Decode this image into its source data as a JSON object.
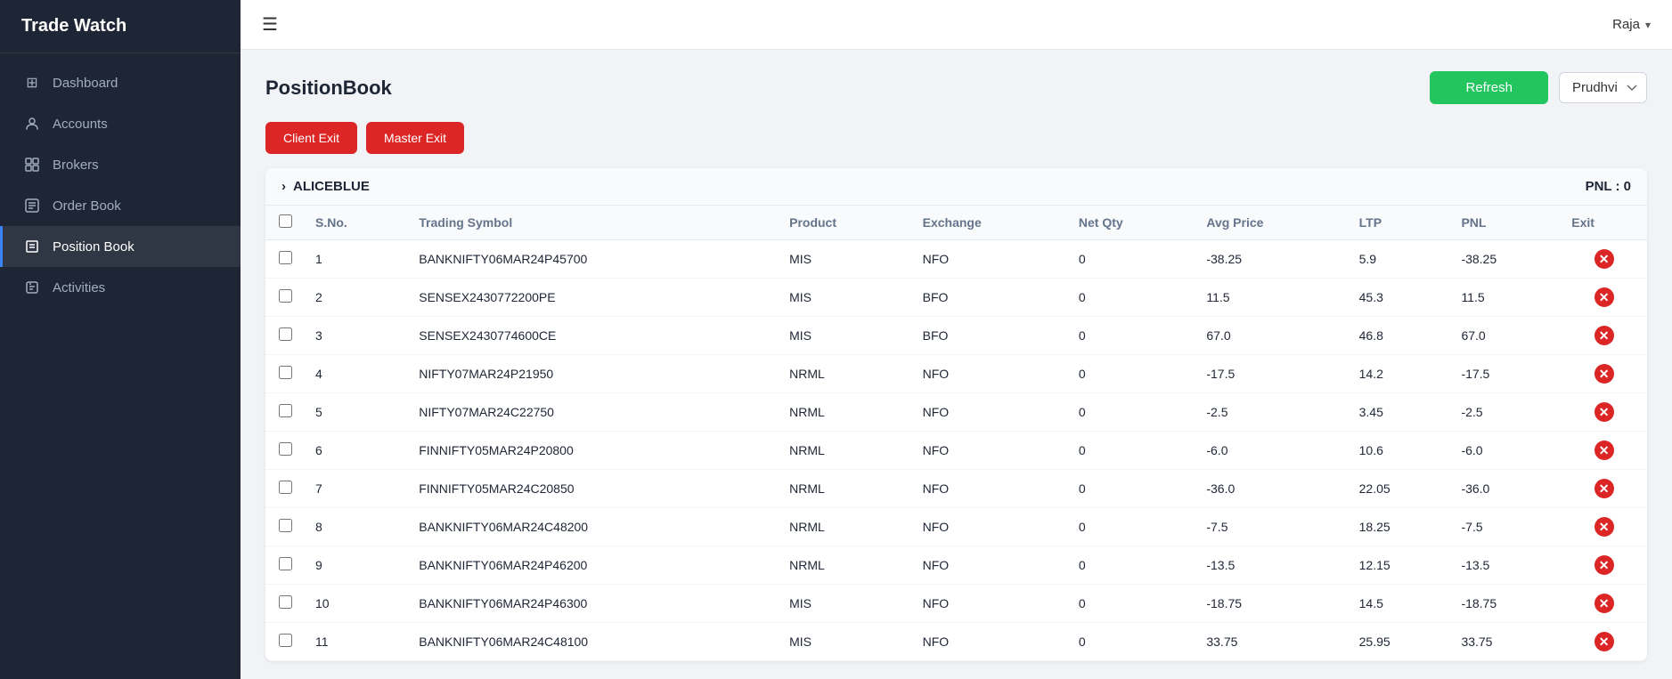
{
  "sidebar": {
    "title": "Trade Watch",
    "items": [
      {
        "id": "dashboard",
        "label": "Dashboard",
        "icon": "⊞",
        "active": false
      },
      {
        "id": "accounts",
        "label": "Accounts",
        "icon": "👤",
        "active": false
      },
      {
        "id": "brokers",
        "label": "Brokers",
        "icon": "⊡",
        "active": false
      },
      {
        "id": "order-book",
        "label": "Order Book",
        "icon": "📋",
        "active": false
      },
      {
        "id": "position-book",
        "label": "Position Book",
        "icon": "🏷",
        "active": true
      },
      {
        "id": "activities",
        "label": "Activities",
        "icon": "📁",
        "active": false
      }
    ]
  },
  "topbar": {
    "user": "Raja",
    "chevron": "▾"
  },
  "page": {
    "title": "PositionBook",
    "refresh_label": "Refresh",
    "dropdown_value": "Prudhvi",
    "client_exit_label": "Client Exit",
    "master_exit_label": "Master Exit"
  },
  "group": {
    "name": "ALICEBLUE",
    "pnl_label": "PNL : 0",
    "chevron": "›"
  },
  "table": {
    "columns": [
      "S.No.",
      "Trading Symbol",
      "Product",
      "Exchange",
      "Net Qty",
      "Avg Price",
      "LTP",
      "PNL",
      "Exit"
    ],
    "rows": [
      {
        "sno": "1",
        "symbol": "BANKNIFTY06MAR24P45700",
        "product": "MIS",
        "exchange": "NFO",
        "netqty": "0",
        "avgprice": "-38.25",
        "ltp": "5.9",
        "pnl": "-38.25"
      },
      {
        "sno": "2",
        "symbol": "SENSEX2430772200PE",
        "product": "MIS",
        "exchange": "BFO",
        "netqty": "0",
        "avgprice": "11.5",
        "ltp": "45.3",
        "pnl": "11.5"
      },
      {
        "sno": "3",
        "symbol": "SENSEX2430774600CE",
        "product": "MIS",
        "exchange": "BFO",
        "netqty": "0",
        "avgprice": "67.0",
        "ltp": "46.8",
        "pnl": "67.0"
      },
      {
        "sno": "4",
        "symbol": "NIFTY07MAR24P21950",
        "product": "NRML",
        "exchange": "NFO",
        "netqty": "0",
        "avgprice": "-17.5",
        "ltp": "14.2",
        "pnl": "-17.5"
      },
      {
        "sno": "5",
        "symbol": "NIFTY07MAR24C22750",
        "product": "NRML",
        "exchange": "NFO",
        "netqty": "0",
        "avgprice": "-2.5",
        "ltp": "3.45",
        "pnl": "-2.5"
      },
      {
        "sno": "6",
        "symbol": "FINNIFTY05MAR24P20800",
        "product": "NRML",
        "exchange": "NFO",
        "netqty": "0",
        "avgprice": "-6.0",
        "ltp": "10.6",
        "pnl": "-6.0"
      },
      {
        "sno": "7",
        "symbol": "FINNIFTY05MAR24C20850",
        "product": "NRML",
        "exchange": "NFO",
        "netqty": "0",
        "avgprice": "-36.0",
        "ltp": "22.05",
        "pnl": "-36.0"
      },
      {
        "sno": "8",
        "symbol": "BANKNIFTY06MAR24C48200",
        "product": "NRML",
        "exchange": "NFO",
        "netqty": "0",
        "avgprice": "-7.5",
        "ltp": "18.25",
        "pnl": "-7.5"
      },
      {
        "sno": "9",
        "symbol": "BANKNIFTY06MAR24P46200",
        "product": "NRML",
        "exchange": "NFO",
        "netqty": "0",
        "avgprice": "-13.5",
        "ltp": "12.15",
        "pnl": "-13.5"
      },
      {
        "sno": "10",
        "symbol": "BANKNIFTY06MAR24P46300",
        "product": "MIS",
        "exchange": "NFO",
        "netqty": "0",
        "avgprice": "-18.75",
        "ltp": "14.5",
        "pnl": "-18.75"
      },
      {
        "sno": "11",
        "symbol": "BANKNIFTY06MAR24C48100",
        "product": "MIS",
        "exchange": "NFO",
        "netqty": "0",
        "avgprice": "33.75",
        "ltp": "25.95",
        "pnl": "33.75"
      }
    ]
  }
}
